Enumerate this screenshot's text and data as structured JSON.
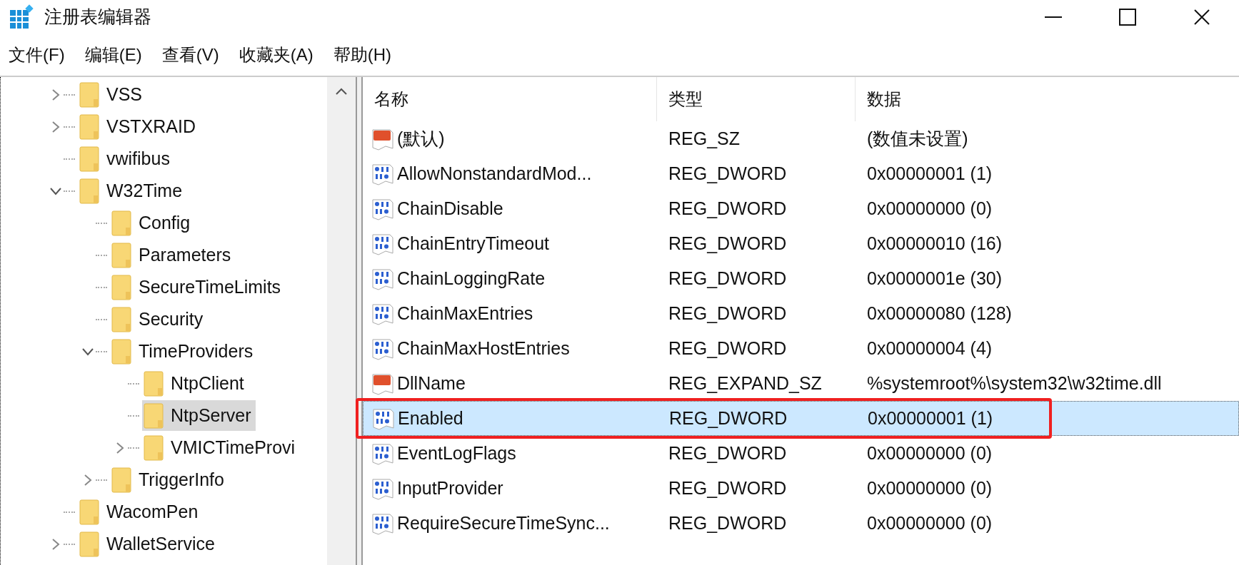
{
  "window": {
    "title": "注册表编辑器"
  },
  "menu": [
    "文件(F)",
    "编辑(E)",
    "查看(V)",
    "收藏夹(A)",
    "帮助(H)"
  ],
  "tree": [
    {
      "label": "VSS",
      "kind": "collapsed",
      "selected": false
    },
    {
      "label": "VSTXRAID",
      "kind": "collapsed",
      "selected": false
    },
    {
      "label": "vwifibus",
      "kind": "leaf",
      "selected": false
    },
    {
      "label": "W32Time",
      "kind": "expanded",
      "selected": false,
      "children": [
        {
          "label": "Config",
          "kind": "leaf",
          "selected": false
        },
        {
          "label": "Parameters",
          "kind": "leaf",
          "selected": false
        },
        {
          "label": "SecureTimeLimits",
          "kind": "leaf",
          "selected": false
        },
        {
          "label": "Security",
          "kind": "leaf",
          "selected": false
        },
        {
          "label": "TimeProviders",
          "kind": "expanded",
          "selected": false,
          "children": [
            {
              "label": "NtpClient",
              "kind": "leaf",
              "selected": false
            },
            {
              "label": "NtpServer",
              "kind": "leaf",
              "selected": true
            },
            {
              "label": "VMICTimeProvi",
              "kind": "collapsed",
              "selected": false
            }
          ]
        },
        {
          "label": "TriggerInfo",
          "kind": "collapsed",
          "selected": false
        }
      ]
    },
    {
      "label": "WacomPen",
      "kind": "leaf",
      "selected": false
    },
    {
      "label": "WalletService",
      "kind": "collapsed",
      "selected": false
    }
  ],
  "table": {
    "columns": [
      "名称",
      "类型",
      "数据"
    ],
    "rows": [
      {
        "kind": "string",
        "name": "(默认)",
        "type": "REG_SZ",
        "data": "(数值未设置)",
        "selected": false
      },
      {
        "kind": "dword",
        "name": "AllowNonstandardMod...",
        "type": "REG_DWORD",
        "data": "0x00000001 (1)",
        "selected": false
      },
      {
        "kind": "dword",
        "name": "ChainDisable",
        "type": "REG_DWORD",
        "data": "0x00000000 (0)",
        "selected": false
      },
      {
        "kind": "dword",
        "name": "ChainEntryTimeout",
        "type": "REG_DWORD",
        "data": "0x00000010 (16)",
        "selected": false
      },
      {
        "kind": "dword",
        "name": "ChainLoggingRate",
        "type": "REG_DWORD",
        "data": "0x0000001e (30)",
        "selected": false
      },
      {
        "kind": "dword",
        "name": "ChainMaxEntries",
        "type": "REG_DWORD",
        "data": "0x00000080 (128)",
        "selected": false
      },
      {
        "kind": "dword",
        "name": "ChainMaxHostEntries",
        "type": "REG_DWORD",
        "data": "0x00000004 (4)",
        "selected": false
      },
      {
        "kind": "string",
        "name": "DllName",
        "type": "REG_EXPAND_SZ",
        "data": "%systemroot%\\system32\\w32time.dll",
        "selected": false
      },
      {
        "kind": "dword",
        "name": "Enabled",
        "type": "REG_DWORD",
        "data": "0x00000001 (1)",
        "selected": true,
        "annotated": true
      },
      {
        "kind": "dword",
        "name": "EventLogFlags",
        "type": "REG_DWORD",
        "data": "0x00000000 (0)",
        "selected": false
      },
      {
        "kind": "dword",
        "name": "InputProvider",
        "type": "REG_DWORD",
        "data": "0x00000000 (0)",
        "selected": false
      },
      {
        "kind": "dword",
        "name": "RequireSecureTimeSync...",
        "type": "REG_DWORD",
        "data": "0x00000000 (0)",
        "selected": false
      }
    ]
  }
}
